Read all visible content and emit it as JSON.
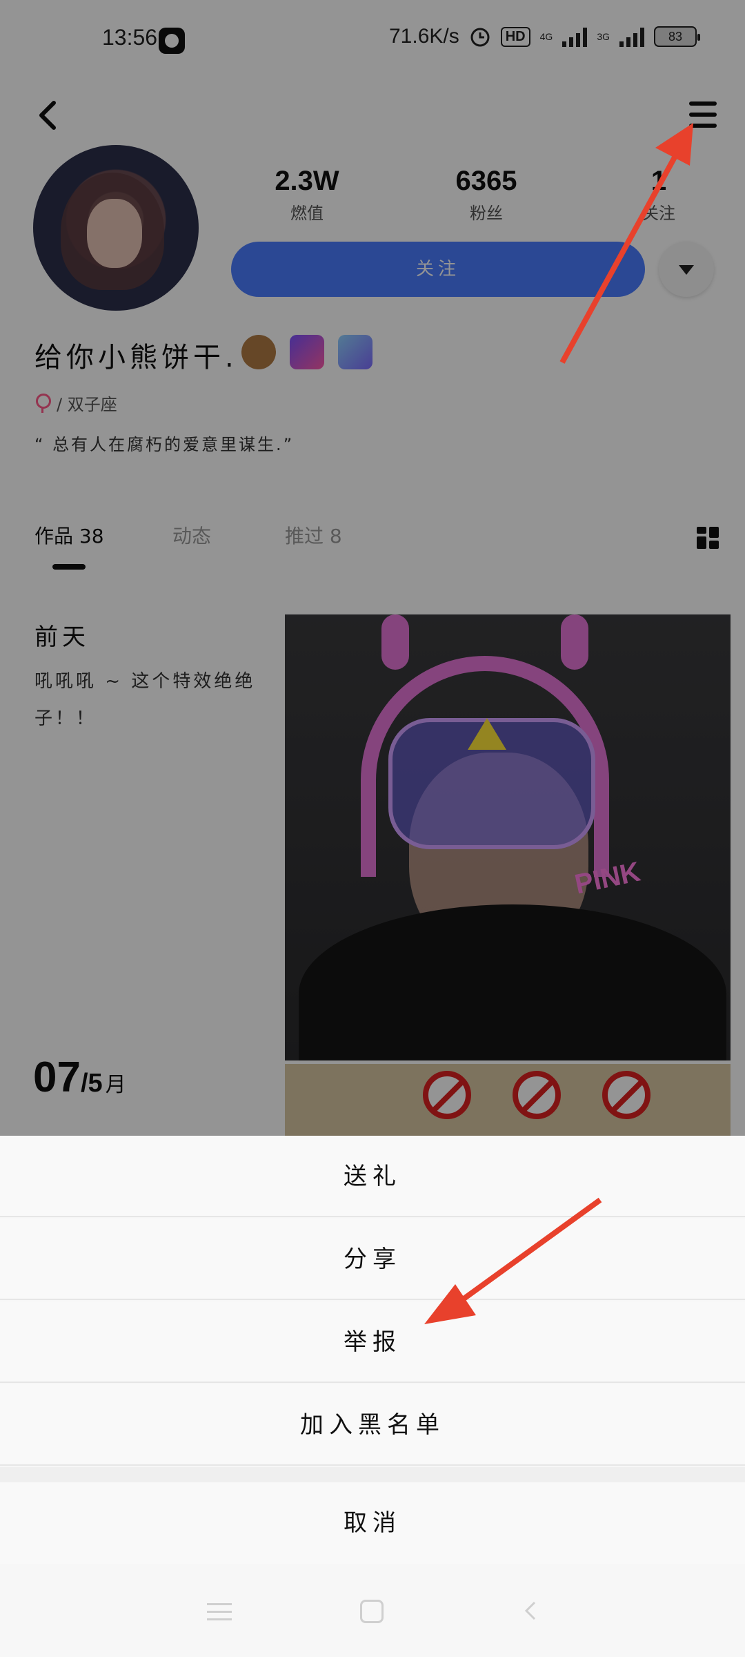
{
  "status_bar": {
    "time": "13:56",
    "net_speed": "71.6K/s",
    "hd_label": "HD",
    "net_4g": "4G",
    "net_3g": "3G",
    "battery": "83"
  },
  "profile": {
    "stats": [
      {
        "value": "2.3W",
        "label": "燃值"
      },
      {
        "value": "6365",
        "label": "粉丝"
      },
      {
        "value": "1",
        "label": "关注"
      }
    ],
    "follow_label": "关注",
    "nickname": "给你小熊饼干.",
    "gender_zodiac": "/ 双子座",
    "bio": "“ 总有人在腐朽的爱意里谋生.”"
  },
  "tabs": [
    {
      "label": "作品 38"
    },
    {
      "label": "动态"
    },
    {
      "label": "推过 8"
    }
  ],
  "post": {
    "date_label": "前天",
    "caption": "吼吼吼 ~ 这个特效绝绝子！！",
    "image_text": "PINK",
    "day": "07",
    "month": "/5",
    "month_unit": "月"
  },
  "sheet": {
    "items": [
      "送礼",
      "分享",
      "举报",
      "加入黑名单"
    ],
    "cancel": "取消"
  },
  "colors": {
    "accent": "#4a7dff",
    "arrow": "#e8412c"
  }
}
